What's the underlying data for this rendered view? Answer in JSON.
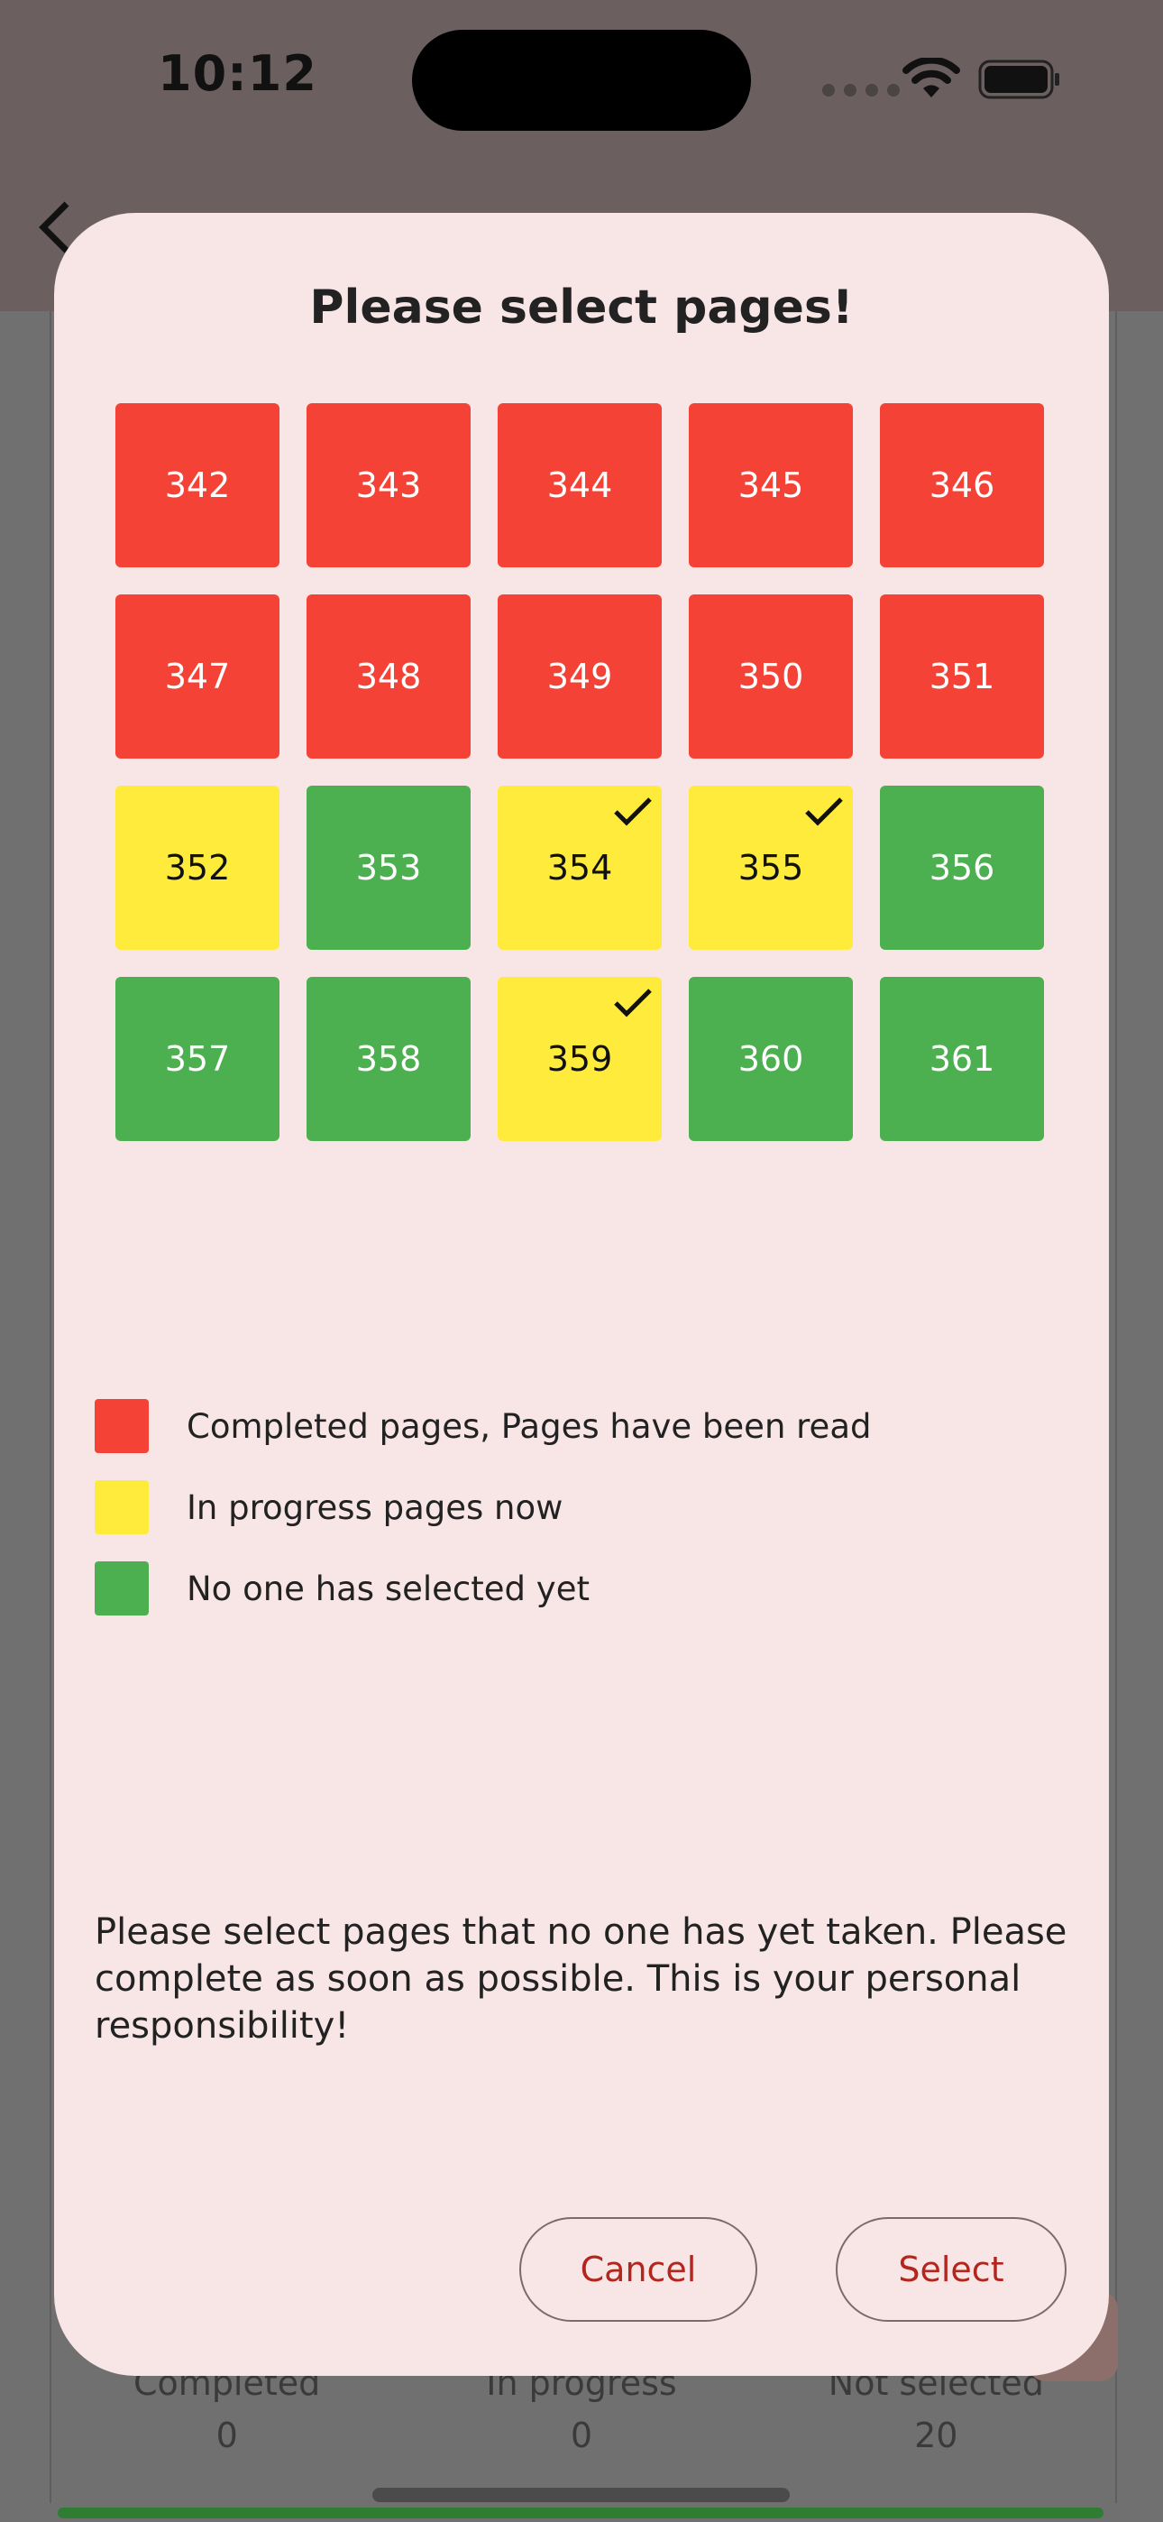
{
  "status_bar": {
    "time": "10:12"
  },
  "background": {
    "stats": [
      {
        "label": "Completed",
        "value": "0"
      },
      {
        "label": "In progress",
        "value": "0"
      },
      {
        "label": "Not selected",
        "value": "20"
      }
    ]
  },
  "dialog": {
    "title": "Please select pages!",
    "pages": [
      {
        "number": "342",
        "status": "completed",
        "checked": false
      },
      {
        "number": "343",
        "status": "completed",
        "checked": false
      },
      {
        "number": "344",
        "status": "completed",
        "checked": false
      },
      {
        "number": "345",
        "status": "completed",
        "checked": false
      },
      {
        "number": "346",
        "status": "completed",
        "checked": false
      },
      {
        "number": "347",
        "status": "completed",
        "checked": false
      },
      {
        "number": "348",
        "status": "completed",
        "checked": false
      },
      {
        "number": "349",
        "status": "completed",
        "checked": false
      },
      {
        "number": "350",
        "status": "completed",
        "checked": false
      },
      {
        "number": "351",
        "status": "completed",
        "checked": false
      },
      {
        "number": "352",
        "status": "progress",
        "checked": false
      },
      {
        "number": "353",
        "status": "free",
        "checked": false
      },
      {
        "number": "354",
        "status": "progress",
        "checked": true
      },
      {
        "number": "355",
        "status": "progress",
        "checked": true
      },
      {
        "number": "356",
        "status": "free",
        "checked": false
      },
      {
        "number": "357",
        "status": "free",
        "checked": false
      },
      {
        "number": "358",
        "status": "free",
        "checked": false
      },
      {
        "number": "359",
        "status": "progress",
        "checked": true
      },
      {
        "number": "360",
        "status": "free",
        "checked": false
      },
      {
        "number": "361",
        "status": "free",
        "checked": false
      }
    ],
    "legend": [
      {
        "color": "#f44336",
        "label": "Completed pages, Pages have been read"
      },
      {
        "color": "#ffeb3b",
        "label": "In progress pages now"
      },
      {
        "color": "#4caf50",
        "label": "No one has selected yet"
      }
    ],
    "instructions": "Please select pages that no one has yet taken. Please complete as soon as possible. This is your personal responsibility!",
    "cancel_label": "Cancel",
    "select_label": "Select"
  },
  "colors": {
    "completed": "#f44336",
    "in_progress": "#ffeb3b",
    "free": "#4caf50",
    "dialog_bg": "#f8e6e6",
    "button_text": "#b3261e"
  }
}
